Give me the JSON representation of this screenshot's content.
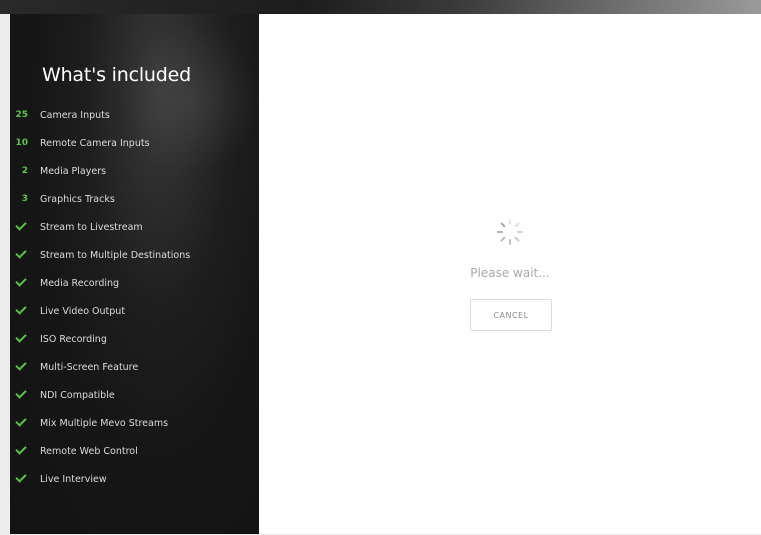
{
  "sidebar": {
    "title": "What's included",
    "items": [
      {
        "mark": "25",
        "label": "Camera Inputs"
      },
      {
        "mark": "10",
        "label": "Remote Camera Inputs"
      },
      {
        "mark": "2",
        "label": "Media Players"
      },
      {
        "mark": "3",
        "label": "Graphics Tracks"
      },
      {
        "mark": "check",
        "label": "Stream to Livestream"
      },
      {
        "mark": "check",
        "label": "Stream to Multiple Destinations"
      },
      {
        "mark": "check",
        "label": "Media Recording"
      },
      {
        "mark": "check",
        "label": "Live Video Output"
      },
      {
        "mark": "check",
        "label": "ISO Recording"
      },
      {
        "mark": "check",
        "label": "Multi-Screen Feature"
      },
      {
        "mark": "check",
        "label": "NDI Compatible"
      },
      {
        "mark": "check",
        "label": "Mix Multiple Mevo Streams"
      },
      {
        "mark": "check",
        "label": "Remote Web Control"
      },
      {
        "mark": "check",
        "label": "Live Interview"
      }
    ]
  },
  "main": {
    "status_text": "Please wait...",
    "cancel_label": "CANCEL",
    "spinner_icon": "loading-spinner-icon"
  },
  "colors": {
    "accent_green": "#5cc24a",
    "sidebar_bg": "#161616",
    "panel_bg": "#ffffff"
  }
}
